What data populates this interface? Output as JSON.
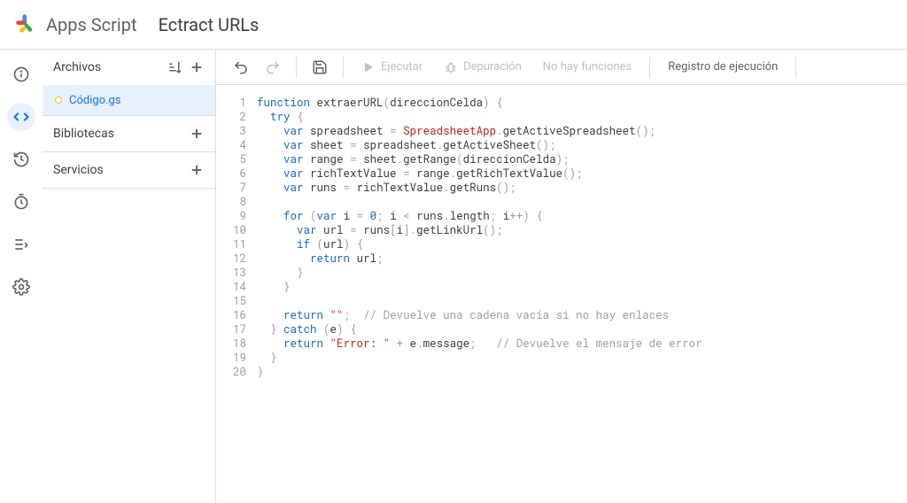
{
  "header": {
    "app_name": "Apps Script",
    "project_name": "Ectract URLs"
  },
  "nav_rail": [
    {
      "name": "info-icon"
    },
    {
      "name": "code-icon"
    },
    {
      "name": "history-icon"
    },
    {
      "name": "clock-icon"
    },
    {
      "name": "list-icon"
    },
    {
      "name": "gear-icon"
    }
  ],
  "sidebar": {
    "files_label": "Archivos",
    "files": [
      {
        "name": "Código.gs",
        "modified": true,
        "active": true
      }
    ],
    "libraries_label": "Bibliotecas",
    "services_label": "Servicios"
  },
  "toolbar": {
    "run_label": "Ejecutar",
    "debug_label": "Depuración",
    "no_functions_label": "No hay funciones",
    "log_label": "Registro de ejecución"
  },
  "code": {
    "lines": [
      {
        "n": 1,
        "tokens": [
          [
            "kw",
            "function"
          ],
          [
            "pun",
            " "
          ],
          [
            "fn",
            "extraerURL"
          ],
          [
            "pun",
            "("
          ],
          [
            "fn",
            "direccionCelda"
          ],
          [
            "pun",
            ") {"
          ]
        ]
      },
      {
        "n": 2,
        "tokens": [
          [
            "pun",
            "  "
          ],
          [
            "kw",
            "try"
          ],
          [
            "pun",
            " {"
          ]
        ]
      },
      {
        "n": 3,
        "tokens": [
          [
            "pun",
            "    "
          ],
          [
            "kw",
            "var"
          ],
          [
            "pun",
            " "
          ],
          [
            "fn",
            "spreadsheet"
          ],
          [
            "pun",
            " = "
          ],
          [
            "typ",
            "SpreadsheetApp"
          ],
          [
            "pun",
            "."
          ],
          [
            "fn",
            "getActiveSpreadsheet"
          ],
          [
            "pun",
            "();"
          ]
        ]
      },
      {
        "n": 4,
        "tokens": [
          [
            "pun",
            "    "
          ],
          [
            "kw",
            "var"
          ],
          [
            "pun",
            " "
          ],
          [
            "fn",
            "sheet"
          ],
          [
            "pun",
            " = "
          ],
          [
            "fn",
            "spreadsheet"
          ],
          [
            "pun",
            "."
          ],
          [
            "fn",
            "getActiveSheet"
          ],
          [
            "pun",
            "();"
          ]
        ]
      },
      {
        "n": 5,
        "tokens": [
          [
            "pun",
            "    "
          ],
          [
            "kw",
            "var"
          ],
          [
            "pun",
            " "
          ],
          [
            "fn",
            "range"
          ],
          [
            "pun",
            " = "
          ],
          [
            "fn",
            "sheet"
          ],
          [
            "pun",
            "."
          ],
          [
            "fn",
            "getRange"
          ],
          [
            "pun",
            "("
          ],
          [
            "fn",
            "direccionCelda"
          ],
          [
            "pun",
            ");"
          ]
        ]
      },
      {
        "n": 6,
        "tokens": [
          [
            "pun",
            "    "
          ],
          [
            "kw",
            "var"
          ],
          [
            "pun",
            " "
          ],
          [
            "fn",
            "richTextValue"
          ],
          [
            "pun",
            " = "
          ],
          [
            "fn",
            "range"
          ],
          [
            "pun",
            "."
          ],
          [
            "fn",
            "getRichTextValue"
          ],
          [
            "pun",
            "();"
          ]
        ]
      },
      {
        "n": 7,
        "tokens": [
          [
            "pun",
            "    "
          ],
          [
            "kw",
            "var"
          ],
          [
            "pun",
            " "
          ],
          [
            "fn",
            "runs"
          ],
          [
            "pun",
            " = "
          ],
          [
            "fn",
            "richTextValue"
          ],
          [
            "pun",
            "."
          ],
          [
            "fn",
            "getRuns"
          ],
          [
            "pun",
            "();"
          ]
        ]
      },
      {
        "n": 8,
        "tokens": []
      },
      {
        "n": 9,
        "tokens": [
          [
            "pun",
            "    "
          ],
          [
            "kw",
            "for"
          ],
          [
            "pun",
            " ("
          ],
          [
            "kw",
            "var"
          ],
          [
            "pun",
            " "
          ],
          [
            "fn",
            "i"
          ],
          [
            "pun",
            " = "
          ],
          [
            "num",
            "0"
          ],
          [
            "pun",
            "; "
          ],
          [
            "fn",
            "i"
          ],
          [
            "pun",
            " < "
          ],
          [
            "fn",
            "runs"
          ],
          [
            "pun",
            "."
          ],
          [
            "fn",
            "length"
          ],
          [
            "pun",
            "; "
          ],
          [
            "fn",
            "i"
          ],
          [
            "pun",
            "++) {"
          ]
        ]
      },
      {
        "n": 10,
        "tokens": [
          [
            "pun",
            "      "
          ],
          [
            "kw",
            "var"
          ],
          [
            "pun",
            " "
          ],
          [
            "fn",
            "url"
          ],
          [
            "pun",
            " = "
          ],
          [
            "fn",
            "runs"
          ],
          [
            "pun",
            "["
          ],
          [
            "fn",
            "i"
          ],
          [
            "pun",
            "]."
          ],
          [
            "fn",
            "getLinkUrl"
          ],
          [
            "pun",
            "();"
          ]
        ]
      },
      {
        "n": 11,
        "tokens": [
          [
            "pun",
            "      "
          ],
          [
            "kw",
            "if"
          ],
          [
            "pun",
            " ("
          ],
          [
            "fn",
            "url"
          ],
          [
            "pun",
            ") {"
          ]
        ]
      },
      {
        "n": 12,
        "tokens": [
          [
            "pun",
            "        "
          ],
          [
            "kw",
            "return"
          ],
          [
            "pun",
            " "
          ],
          [
            "fn",
            "url"
          ],
          [
            "pun",
            ";"
          ]
        ]
      },
      {
        "n": 13,
        "tokens": [
          [
            "pun",
            "      }"
          ]
        ]
      },
      {
        "n": 14,
        "tokens": [
          [
            "pun",
            "    }"
          ]
        ]
      },
      {
        "n": 15,
        "tokens": []
      },
      {
        "n": 16,
        "tokens": [
          [
            "pun",
            "    "
          ],
          [
            "kw",
            "return"
          ],
          [
            "pun",
            " "
          ],
          [
            "str",
            "\"\""
          ],
          [
            "pun",
            ";  "
          ],
          [
            "com",
            "// Devuelve una cadena vacía si no hay enlaces"
          ]
        ]
      },
      {
        "n": 17,
        "tokens": [
          [
            "pun",
            "  } "
          ],
          [
            "kw",
            "catch"
          ],
          [
            "pun",
            " ("
          ],
          [
            "fn",
            "e"
          ],
          [
            "pun",
            ") {"
          ]
        ]
      },
      {
        "n": 18,
        "tokens": [
          [
            "pun",
            "    "
          ],
          [
            "kw",
            "return"
          ],
          [
            "pun",
            " "
          ],
          [
            "str",
            "\"Error: \""
          ],
          [
            "pun",
            " + "
          ],
          [
            "fn",
            "e"
          ],
          [
            "pun",
            "."
          ],
          [
            "fn",
            "message"
          ],
          [
            "pun",
            ";   "
          ],
          [
            "com",
            "// Devuelve el mensaje de error"
          ]
        ]
      },
      {
        "n": 19,
        "tokens": [
          [
            "pun",
            "  }"
          ]
        ]
      },
      {
        "n": 20,
        "tokens": [
          [
            "pun",
            "}"
          ]
        ]
      }
    ]
  }
}
